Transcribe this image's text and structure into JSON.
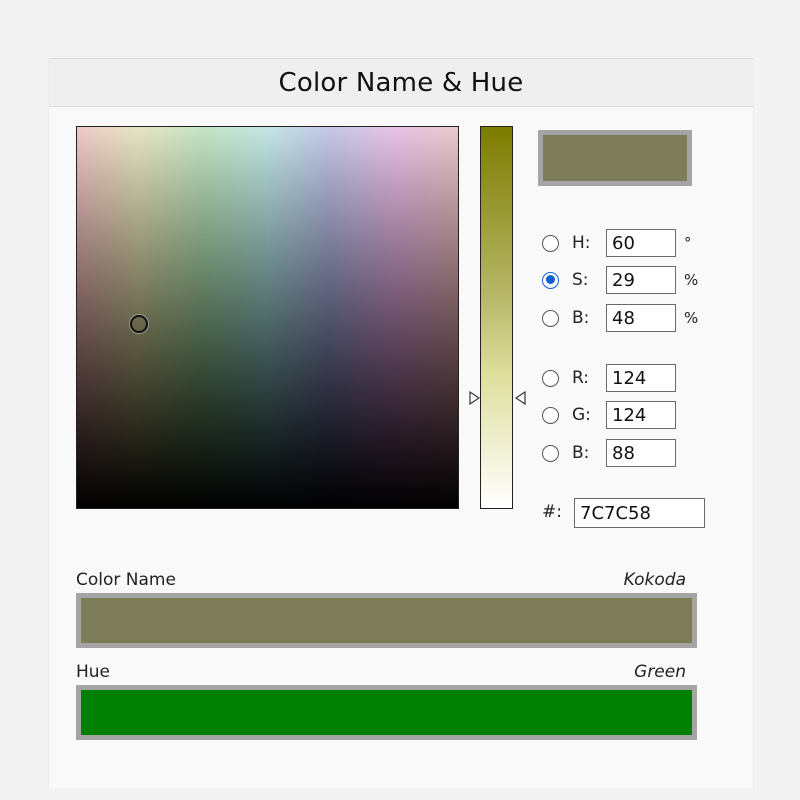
{
  "title": "Color Name & Hue",
  "colors": {
    "current": "#7C7C58",
    "hue_color": "#008000"
  },
  "state": {
    "selected_mode": "S"
  },
  "fields": {
    "h": {
      "label": "H:",
      "value": "60",
      "unit": "°"
    },
    "s": {
      "label": "S:",
      "value": "29",
      "unit": "%"
    },
    "bri": {
      "label": "B:",
      "value": "48",
      "unit": "%"
    },
    "r": {
      "label": "R:",
      "value": "124"
    },
    "g": {
      "label": "G:",
      "value": "124"
    },
    "blue": {
      "label": "B:",
      "value": "88"
    },
    "hex": {
      "label": "#:",
      "value": "7C7C58"
    }
  },
  "color_name": {
    "label": "Color Name",
    "value": "Kokoda"
  },
  "hue": {
    "label": "Hue",
    "value": "Green"
  }
}
